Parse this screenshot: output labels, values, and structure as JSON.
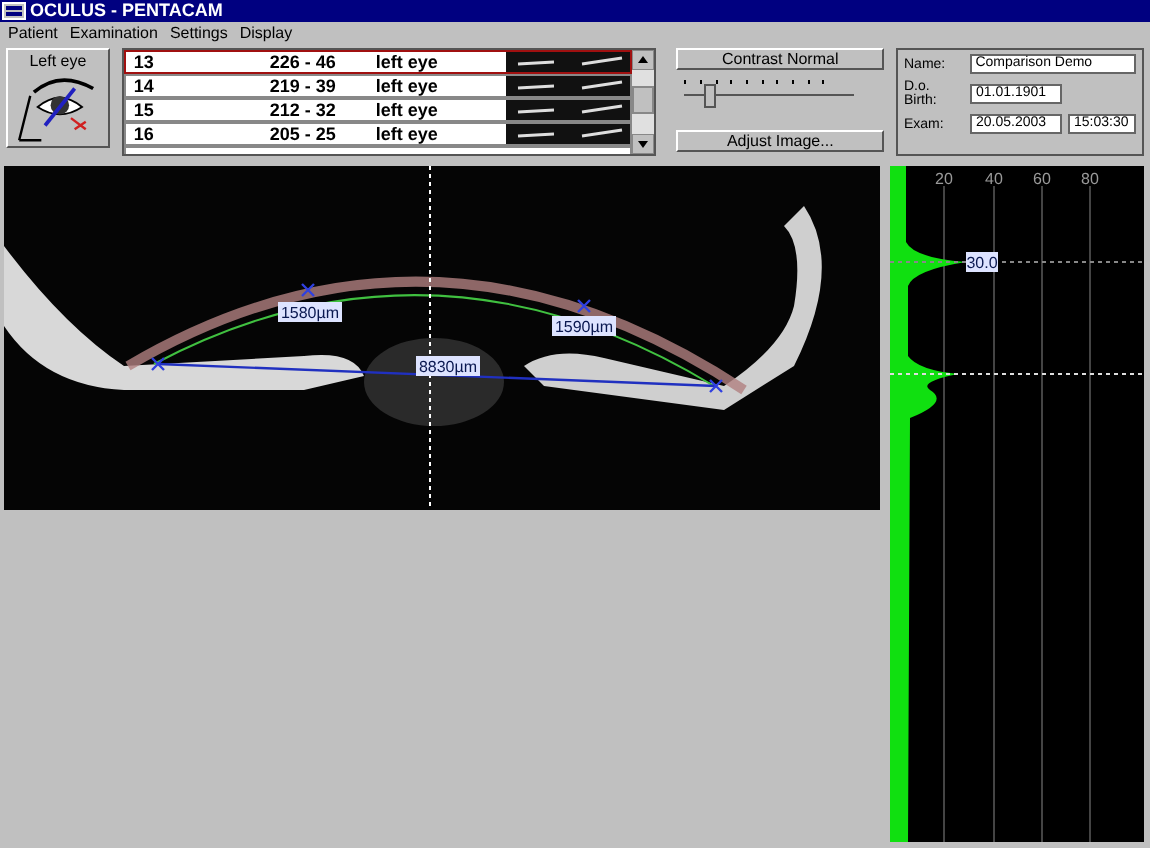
{
  "window": {
    "title": "OCULUS  -  PENTACAM"
  },
  "menu": [
    "Patient",
    "Examination",
    "Settings",
    "Display"
  ],
  "eye_button": {
    "label": "Left eye"
  },
  "scans": [
    {
      "number": "13",
      "values": "226 - 46",
      "eye": "left eye",
      "selected": true
    },
    {
      "number": "14",
      "values": "219 - 39",
      "eye": "left eye",
      "selected": false
    },
    {
      "number": "15",
      "values": "212 - 32",
      "eye": "left eye",
      "selected": false
    },
    {
      "number": "16",
      "values": "205 - 25",
      "eye": "left eye",
      "selected": false
    }
  ],
  "contrast_button": "Contrast Normal",
  "contrast_slider": {
    "level": 0.12
  },
  "adjust_button": "Adjust Image...",
  "patient": {
    "name_label": "Name:",
    "name": "Comparison Demo",
    "dob_label": "D.o. Birth:",
    "dob": "01.01.1901",
    "exam_label": "Exam:",
    "exam_date": "20.05.2003",
    "exam_time": "15:03:30"
  },
  "image": {
    "measurements": [
      {
        "label": "1580µm"
      },
      {
        "label": "1590µm"
      },
      {
        "label": "8830µm"
      }
    ]
  },
  "density_profile": {
    "scale_labels": [
      "20",
      "40",
      "60",
      "80"
    ],
    "marker_value": "30.0"
  }
}
